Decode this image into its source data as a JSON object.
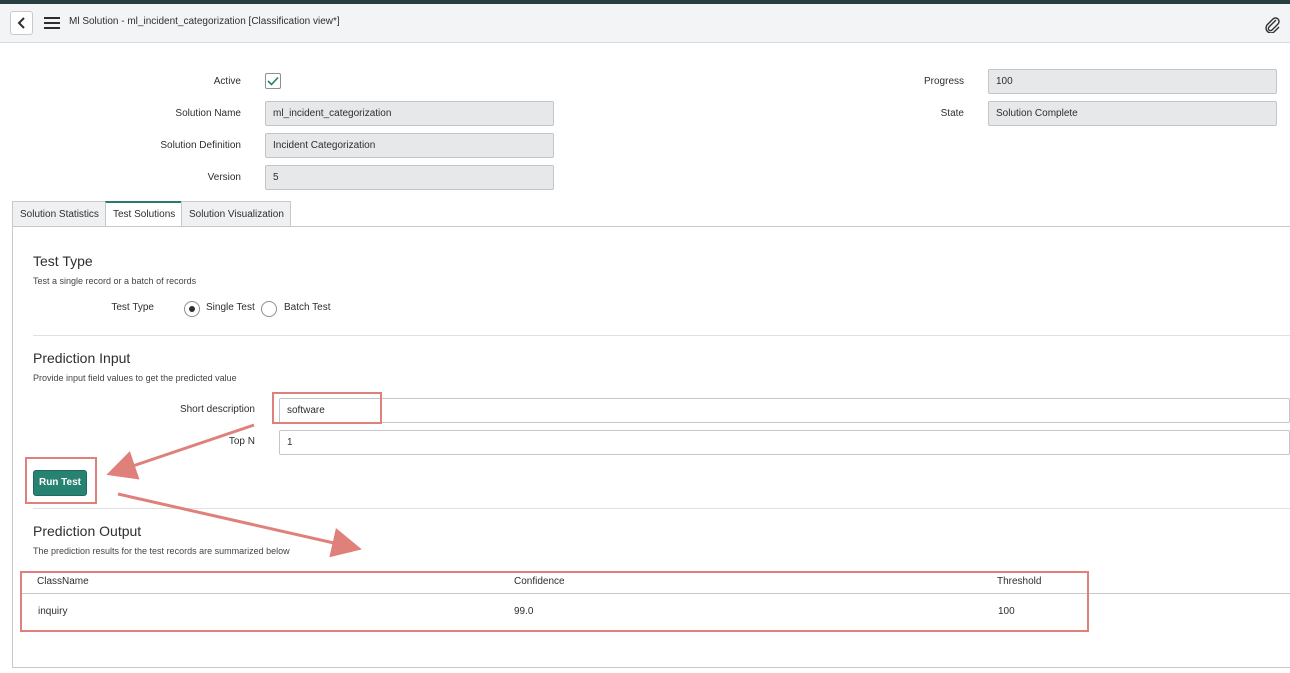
{
  "header": {
    "title_main": "Ml Solution - ml_incident_categorization",
    "title_view": "[Classification view*]",
    "back_icon": "chevron-left-icon",
    "menu_icon": "hamburger-menu-icon",
    "attach_icon": "paperclip-icon"
  },
  "form": {
    "active_label": "Active",
    "active_checked": true,
    "solution_name_label": "Solution Name",
    "solution_name_value": "ml_incident_categorization",
    "solution_definition_label": "Solution Definition",
    "solution_definition_value": "Incident Categorization",
    "version_label": "Version",
    "version_value": "5",
    "progress_label": "Progress",
    "progress_value": "100",
    "state_label": "State",
    "state_value": "Solution Complete"
  },
  "tabs": [
    {
      "label": "Solution Statistics",
      "active": false
    },
    {
      "label": "Test Solutions",
      "active": true
    },
    {
      "label": "Solution Visualization",
      "active": false
    }
  ],
  "test_type": {
    "title": "Test Type",
    "description": "Test a single record or a batch of records",
    "field_label": "Test Type",
    "options": [
      {
        "label": "Single Test",
        "selected": true
      },
      {
        "label": "Batch Test",
        "selected": false
      }
    ]
  },
  "prediction_input": {
    "title": "Prediction Input",
    "description": "Provide input field values to get the predicted value",
    "short_description_label": "Short description",
    "short_description_value": "software",
    "top_n_label": "Top N",
    "top_n_value": "1",
    "run_button": "Run Test"
  },
  "prediction_output": {
    "title": "Prediction Output",
    "description": "The prediction results for the test records are summarized below",
    "columns": [
      "ClassName",
      "Confidence",
      "Threshold"
    ],
    "rows": [
      [
        "inquiry",
        "99.0",
        "100"
      ]
    ]
  },
  "colors": {
    "accent": "#278271",
    "annotation": "#e0807a",
    "header_bg": "#f3f4f5"
  }
}
